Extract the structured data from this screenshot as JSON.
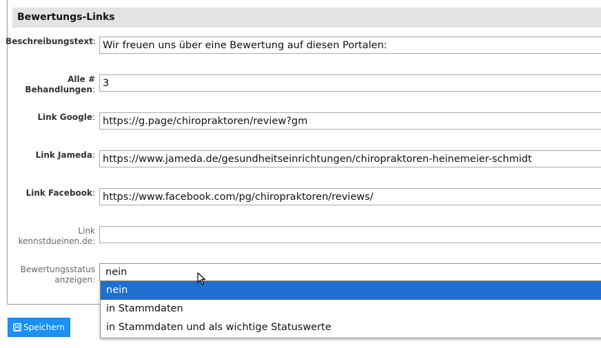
{
  "section": {
    "title": "Bewertungs-Links"
  },
  "fields": {
    "beschreibung": {
      "label": "Beschreibungstext",
      "value": "Wir freuen uns über eine Bewertung auf diesen Portalen:"
    },
    "behandlungen": {
      "label_line1": "Alle #",
      "label_line2": "Behandlungen",
      "value": "3"
    },
    "google": {
      "label": "Link Google",
      "value": "https://g.page/chiropraktoren/review?gm"
    },
    "jameda": {
      "label": "Link Jameda",
      "value": "https://www.jameda.de/gesundheitseinrichtungen/chiropraktoren-heinemeier-schmidt"
    },
    "facebook": {
      "label": "Link Facebook",
      "value": "https://www.facebook.com/pg/chiropraktoren/reviews/"
    },
    "kennstdueinen": {
      "label_line1": "Link",
      "label_line2": "kennstdueinen.de",
      "value": ""
    },
    "status": {
      "label_line1": "Bewertungsstatus",
      "label_line2": "anzeigen",
      "value": "nein"
    }
  },
  "dropdown": {
    "options": [
      "nein",
      "in Stammdaten",
      "in Stammdaten und als wichtige Statuswerte"
    ]
  },
  "save_button": {
    "label": "Speichern",
    "icon": "floppy-disk-icon"
  },
  "colors": {
    "accent": "#1d8ff0",
    "selected_option": "#1e6fd0",
    "header_bg": "#e3e3e3"
  }
}
